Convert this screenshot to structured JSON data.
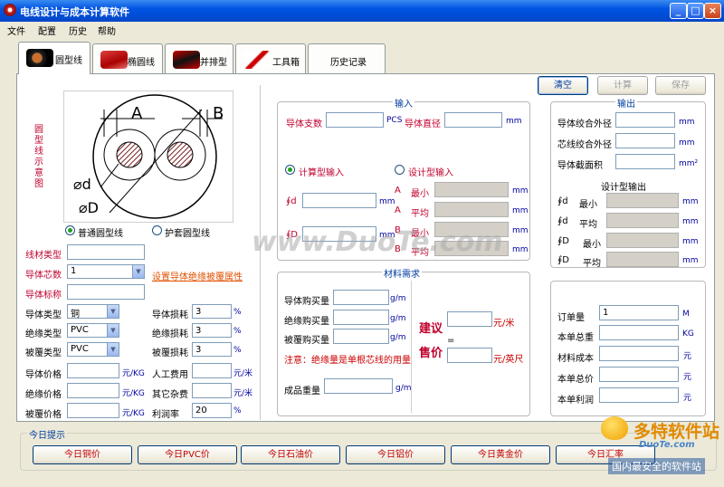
{
  "window": {
    "title": "电线设计与成本计算软件",
    "min": "_",
    "max": "□",
    "close": "×"
  },
  "menu": [
    "文件",
    "配置",
    "历史",
    "帮助"
  ],
  "tabs": [
    {
      "label": "圆型线"
    },
    {
      "label": "椭圆线"
    },
    {
      "label": "并排型"
    },
    {
      "label": "工具箱"
    },
    {
      "label": "历史记录"
    }
  ],
  "actions": {
    "clear": "清空",
    "calc": "计算",
    "save": "保存"
  },
  "diagram": {
    "vertical_label": [
      "圆",
      "型",
      "线",
      "示",
      "意",
      "图"
    ],
    "A": "A",
    "B": "B",
    "d": "⌀d",
    "D": "⌀D",
    "radio_normal": "普通圆型线",
    "radio_sheath": "护套圆型线"
  },
  "left": {
    "wire_type_label": "线材类型",
    "wire_type_value": "",
    "cores_label": "导体芯数",
    "cores_value": "1",
    "insulation_link": "设置导体绝缘被覆属性",
    "conductor_mark_label": "导体标称",
    "conductor_mark_value": "",
    "cond_type_label": "导体类型",
    "cond_type_value": "铜",
    "ins_type_label": "绝缘类型",
    "ins_type_value": "PVC",
    "jacket_type_label": "被覆类型",
    "jacket_type_value": "PVC",
    "cond_loss_label": "导体损耗",
    "cond_loss_value": "3",
    "ins_loss_label": "绝缘损耗",
    "ins_loss_value": "3",
    "jacket_loss_label": "被覆损耗",
    "jacket_loss_value": "3",
    "percent": "%",
    "cond_price_label": "导体价格",
    "ins_price_label": "绝缘价格",
    "jacket_price_label": "被覆价格",
    "labor_label": "人工费用",
    "misc_label": "其它杂费",
    "profit_label": "利润率",
    "profit_value": "20",
    "unit_kg": "元/KG",
    "unit_m": "元/米"
  },
  "input": {
    "title": "输入",
    "count_label": "导体支数",
    "pcs": "PCS",
    "dia_label": "导体直径",
    "mm": "mm",
    "calc_radio": "计算型输入",
    "design_radio": "设计型输入",
    "phi_d": "∮d",
    "phi_D": "∮D",
    "rows": [
      {
        "k": "A",
        "l": "最小"
      },
      {
        "k": "A",
        "l": "平均"
      },
      {
        "k": "B",
        "l": "最小"
      },
      {
        "k": "B",
        "l": "平均"
      }
    ]
  },
  "material": {
    "title": "材料需求",
    "cond_buy": "导体购买量",
    "ins_buy": "绝缘购买量",
    "jacket_buy": "被覆购买量",
    "unit": "g/m",
    "note": "注意：绝缘量是单根芯线的用量",
    "product_weight": "成品重量",
    "suggest": [
      "建",
      "议"
    ],
    "sale": [
      "售",
      "价"
    ],
    "eq": "=",
    "yuan_m": "元/米",
    "yuan_ft": "元/英尺"
  },
  "output": {
    "title": "输出",
    "twist_outer": "导体绞合外径",
    "core_outer": "芯线绞合外径",
    "cross_area": "导体截面积",
    "mm": "mm",
    "mm2": "mm²",
    "design_title": "设计型输出",
    "rows": [
      {
        "k": "∮d",
        "l": "最小"
      },
      {
        "k": "∮d",
        "l": "平均"
      },
      {
        "k": "∮D",
        "l": "最小"
      },
      {
        "k": "∮D",
        "l": "平均"
      }
    ]
  },
  "order": {
    "qty_label": "订单量",
    "qty_value": "1",
    "qty_unit": "M",
    "weight_label": "本单总重",
    "weight_unit": "KG",
    "material_cost_label": "材料成本",
    "total_price_label": "本单总价",
    "profit_label": "本单利润",
    "yuan": "元"
  },
  "today": {
    "title": "今日提示",
    "buttons": [
      "今日铜价",
      "今日PVC价",
      "今日石油价",
      "今日铝价",
      "今日黄金价",
      "今日汇率"
    ]
  },
  "watermark": {
    "center": "www.DuoTe.com",
    "brand": "多特软件站",
    "brand_url": "DuoTe.com",
    "brand_sub": "国内最安全的软件站"
  }
}
